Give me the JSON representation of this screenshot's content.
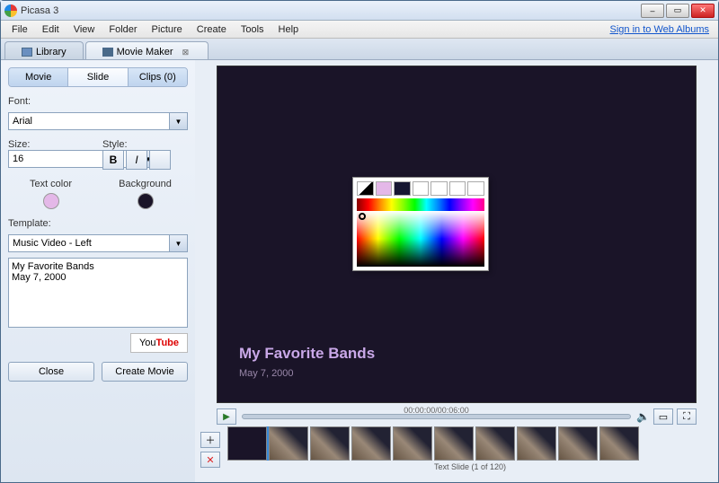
{
  "window": {
    "title": "Picasa 3"
  },
  "menu": [
    "File",
    "Edit",
    "View",
    "Folder",
    "Picture",
    "Create",
    "Tools",
    "Help"
  ],
  "menu_link": "Sign in to Web Albums",
  "tabs": {
    "library": "Library",
    "active": "Movie Maker"
  },
  "subtabs": {
    "movie": "Movie",
    "slide": "Slide",
    "clips": "Clips (0)"
  },
  "font": {
    "label": "Font:",
    "value": "Arial"
  },
  "size": {
    "label": "Size:",
    "value": "16"
  },
  "style": {
    "label": "Style:",
    "bold": "B",
    "italic": "I"
  },
  "textcolor": {
    "label": "Text color",
    "hex": "#e4b8e8"
  },
  "bgcolor": {
    "label": "Background",
    "hex": "#1a1428"
  },
  "template": {
    "label": "Template:",
    "value": "Music Video - Left"
  },
  "caption_text": "My Favorite Bands\nMay 7, 2000",
  "youtube": {
    "you": "You",
    "tube": "Tube"
  },
  "buttons": {
    "close": "Close",
    "create": "Create Movie"
  },
  "preview": {
    "title": "My Favorite Bands",
    "date": "May 7, 2000"
  },
  "timecode": "00:00:00/00:06:00",
  "filmstrip": {
    "status": "Text Slide   (1 of 120)"
  },
  "picker_swatches": [
    "#000000",
    "#e4b8e8",
    "#161632",
    "#ffffff",
    "#ffffff",
    "#ffffff",
    "#ffffff"
  ]
}
